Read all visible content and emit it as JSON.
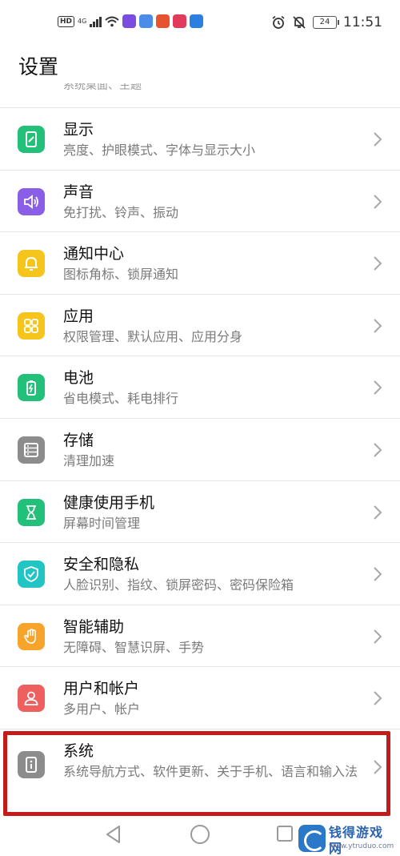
{
  "status_bar": {
    "hd": "HD",
    "network": "4G",
    "battery": "24",
    "time": "11:51"
  },
  "page_title": "设置",
  "peek_text": "系统桌面、主题",
  "items": [
    {
      "label": "显示",
      "sub": "亮度、护眼模式、字体与显示大小",
      "icon": "display-icon",
      "color": "#23c07a"
    },
    {
      "label": "声音",
      "sub": "免打扰、铃声、振动",
      "icon": "sound-icon",
      "color": "#8a5ee6"
    },
    {
      "label": "通知中心",
      "sub": "图标角标、锁屏通知",
      "icon": "bell-icon",
      "color": "#f6c51c"
    },
    {
      "label": "应用",
      "sub": "权限管理、默认应用、应用分身",
      "icon": "apps-icon",
      "color": "#f6c51c"
    },
    {
      "label": "电池",
      "sub": "省电模式、耗电排行",
      "icon": "battery-icon",
      "color": "#23c07a"
    },
    {
      "label": "存储",
      "sub": "清理加速",
      "icon": "storage-icon",
      "color": "#8c8c8c"
    },
    {
      "label": "健康使用手机",
      "sub": "屏幕时间管理",
      "icon": "hourglass-icon",
      "color": "#23c07a"
    },
    {
      "label": "安全和隐私",
      "sub": "人脸识别、指纹、锁屏密码、密码保险箱",
      "icon": "shield-icon",
      "color": "#22c4c4"
    },
    {
      "label": "智能辅助",
      "sub": "无障碍、智慧识屏、手势",
      "icon": "hand-icon",
      "color": "#f6a52a"
    },
    {
      "label": "用户和帐户",
      "sub": "多用户、帐户",
      "icon": "user-icon",
      "color": "#ee5f5f"
    },
    {
      "label": "系统",
      "sub": "系统导航方式、软件更新、关于手机、语言和输入法",
      "icon": "system-info-icon",
      "color": "#8c8c8c"
    }
  ],
  "watermark": {
    "title": "钱得游戏网",
    "url": "www.ytruduo.com"
  }
}
